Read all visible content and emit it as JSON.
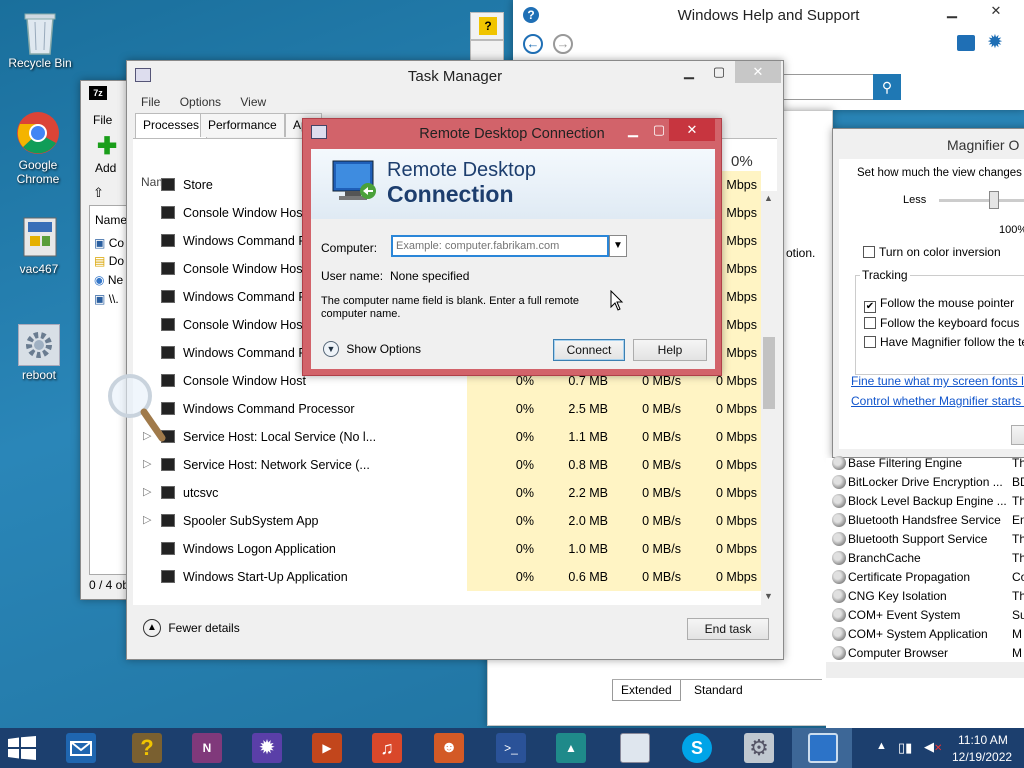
{
  "desktop": {
    "icons": [
      {
        "label": "Recycle Bin"
      },
      {
        "label": "Google Chrome"
      },
      {
        "label": "vac467"
      },
      {
        "label": "reboot"
      }
    ]
  },
  "help": {
    "title": "Windows Help and Support"
  },
  "sevenzip": {
    "menu_file": "File",
    "add_label": "Add",
    "col_name": "Name",
    "items": [
      "Co",
      "Do",
      "Ne",
      "\\\\."
    ],
    "status": "0 / 4 ob"
  },
  "task_manager": {
    "title": "Task Manager",
    "menu": [
      "File",
      "Options",
      "View"
    ],
    "tabs": [
      "Processes",
      "Performance",
      "App"
    ],
    "col_name": "Name",
    "network_pct": "0%",
    "network_label": "twork",
    "rows": [
      {
        "name": "Store",
        "cpu": "",
        "mem": "",
        "disk": "",
        "net": "Mbps",
        "exp": false
      },
      {
        "name": "Console Window Host",
        "cpu": "",
        "mem": "",
        "disk": "",
        "net": "Mbps",
        "exp": false
      },
      {
        "name": "Windows Command P",
        "cpu": "",
        "mem": "",
        "disk": "",
        "net": "Mbps",
        "exp": false
      },
      {
        "name": "Console Window Host",
        "cpu": "",
        "mem": "",
        "disk": "",
        "net": "Mbps",
        "exp": false
      },
      {
        "name": "Windows Command P",
        "cpu": "",
        "mem": "",
        "disk": "",
        "net": "Mbps",
        "exp": false
      },
      {
        "name": "Console Window Host",
        "cpu": "",
        "mem": "",
        "disk": "",
        "net": "Mbps",
        "exp": false
      },
      {
        "name": "Windows Command P",
        "cpu": "",
        "mem": "",
        "disk": "",
        "net": "Mbps",
        "exp": false
      },
      {
        "name": "Console Window Host",
        "cpu": "0%",
        "mem": "0.7 MB",
        "disk": "0 MB/s",
        "net": "0 Mbps",
        "exp": false
      },
      {
        "name": "Windows Command Processor",
        "cpu": "0%",
        "mem": "2.5 MB",
        "disk": "0 MB/s",
        "net": "0 Mbps",
        "exp": false
      },
      {
        "name": "Service Host: Local Service (No l...",
        "cpu": "0%",
        "mem": "1.1 MB",
        "disk": "0 MB/s",
        "net": "0 Mbps",
        "exp": true
      },
      {
        "name": "Service Host: Network Service (...",
        "cpu": "0%",
        "mem": "0.8 MB",
        "disk": "0 MB/s",
        "net": "0 Mbps",
        "exp": true
      },
      {
        "name": "utcsvc",
        "cpu": "0%",
        "mem": "2.2 MB",
        "disk": "0 MB/s",
        "net": "0 Mbps",
        "exp": true
      },
      {
        "name": "Spooler SubSystem App",
        "cpu": "0%",
        "mem": "2.0 MB",
        "disk": "0 MB/s",
        "net": "0 Mbps",
        "exp": true
      },
      {
        "name": "Windows Logon Application",
        "cpu": "0%",
        "mem": "1.0 MB",
        "disk": "0 MB/s",
        "net": "0 Mbps",
        "exp": false
      },
      {
        "name": "Windows Start-Up Application",
        "cpu": "0%",
        "mem": "0.6 MB",
        "disk": "0 MB/s",
        "net": "0 Mbps",
        "exp": false
      }
    ],
    "fewer_details": "Fewer details",
    "end_task": "End task"
  },
  "rdc": {
    "title": "Remote Desktop Connection",
    "banner_line1": "Remote Desktop",
    "banner_line2": "Connection",
    "computer_label": "Computer:",
    "computer_placeholder": "Example: computer.fabrikam.com",
    "username_label": "User name:",
    "username_value": "None specified",
    "message": "The computer name field is blank. Enter a full remote computer name.",
    "show_options": "Show Options",
    "connect": "Connect",
    "help": "Help"
  },
  "magnifier": {
    "title": "Magnifier O",
    "desc": "Set how much the view changes",
    "less": "Less",
    "pct": "100%",
    "color_inversion": "Turn on color inversion",
    "tracking": "Tracking",
    "follow_mouse": "Follow the mouse pointer",
    "follow_keyboard": "Follow the keyboard focus",
    "follow_text": "Have Magnifier follow the te",
    "link1": "Fine tune what my screen fonts lo",
    "link2": "Control whether Magnifier starts v",
    "behind_text": "otion."
  },
  "services": {
    "rows": [
      {
        "name": "Base Filtering Engine",
        "desc": "Th"
      },
      {
        "name": "BitLocker Drive Encryption ...",
        "desc": "BD"
      },
      {
        "name": "Block Level Backup Engine ...",
        "desc": "Th"
      },
      {
        "name": "Bluetooth Handsfree Service",
        "desc": "En"
      },
      {
        "name": "Bluetooth Support Service",
        "desc": "Th"
      },
      {
        "name": "BranchCache",
        "desc": "Th"
      },
      {
        "name": "Certificate Propagation",
        "desc": "Co"
      },
      {
        "name": "CNG Key Isolation",
        "desc": "Th"
      },
      {
        "name": "COM+ Event System",
        "desc": "Su"
      },
      {
        "name": "COM+ System Application",
        "desc": "M"
      },
      {
        "name": "Computer Browser",
        "desc": "M"
      }
    ],
    "tab_extended": "Extended",
    "tab_standard": "Standard"
  },
  "taskbar": {
    "time": "11:10 AM",
    "date": "12/19/2022"
  },
  "colors": {
    "rdc_border": "#c9505a",
    "taskbar": "#1c3f6e",
    "highlight_col": "#fff4c4"
  }
}
